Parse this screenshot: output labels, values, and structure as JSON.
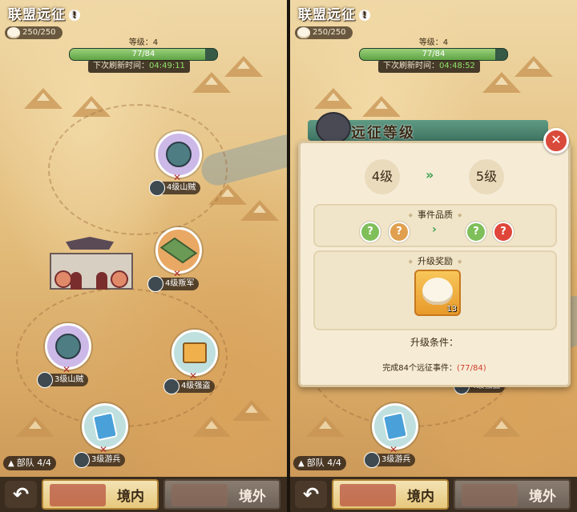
{
  "title": "联盟远征",
  "stamina": "250/250",
  "level": {
    "label": "等级：4",
    "progress_text": "77/84",
    "progress": 0.917
  },
  "left": {
    "refresh_label": "下次刷新时间：",
    "refresh_time": "04:49:11",
    "nodes": [
      {
        "label": "4级山贼",
        "type": "bandit"
      },
      {
        "label": "4级叛军",
        "type": "rebel"
      },
      {
        "label": "3级山贼",
        "type": "bandit"
      },
      {
        "label": "4级强盗",
        "type": "robber"
      },
      {
        "label": "3级游兵",
        "type": "wanderer"
      }
    ]
  },
  "right": {
    "refresh_label": "下次刷新时间：",
    "refresh_time": "04:48:52",
    "nodes": [
      {
        "label": "4级强盗"
      },
      {
        "label": "3级游兵"
      }
    ]
  },
  "team": "部队 4/4",
  "tabs": {
    "inner": "境内",
    "outer": "境外"
  },
  "dialog": {
    "title": "远征等级",
    "from_level": "4级",
    "to_level": "5级",
    "arrow": "»",
    "quality_title": "事件品质",
    "quality_mark": "?",
    "reward_title": "升级奖励",
    "reward_count": "13",
    "condition_title": "升级条件：",
    "condition_text": "完成84个远征事件：",
    "condition_progress": "(77/84)"
  },
  "colors": {
    "accent_green": "#3aa050",
    "progress_red": "#d0402e",
    "close_red": "#d94a3a"
  }
}
